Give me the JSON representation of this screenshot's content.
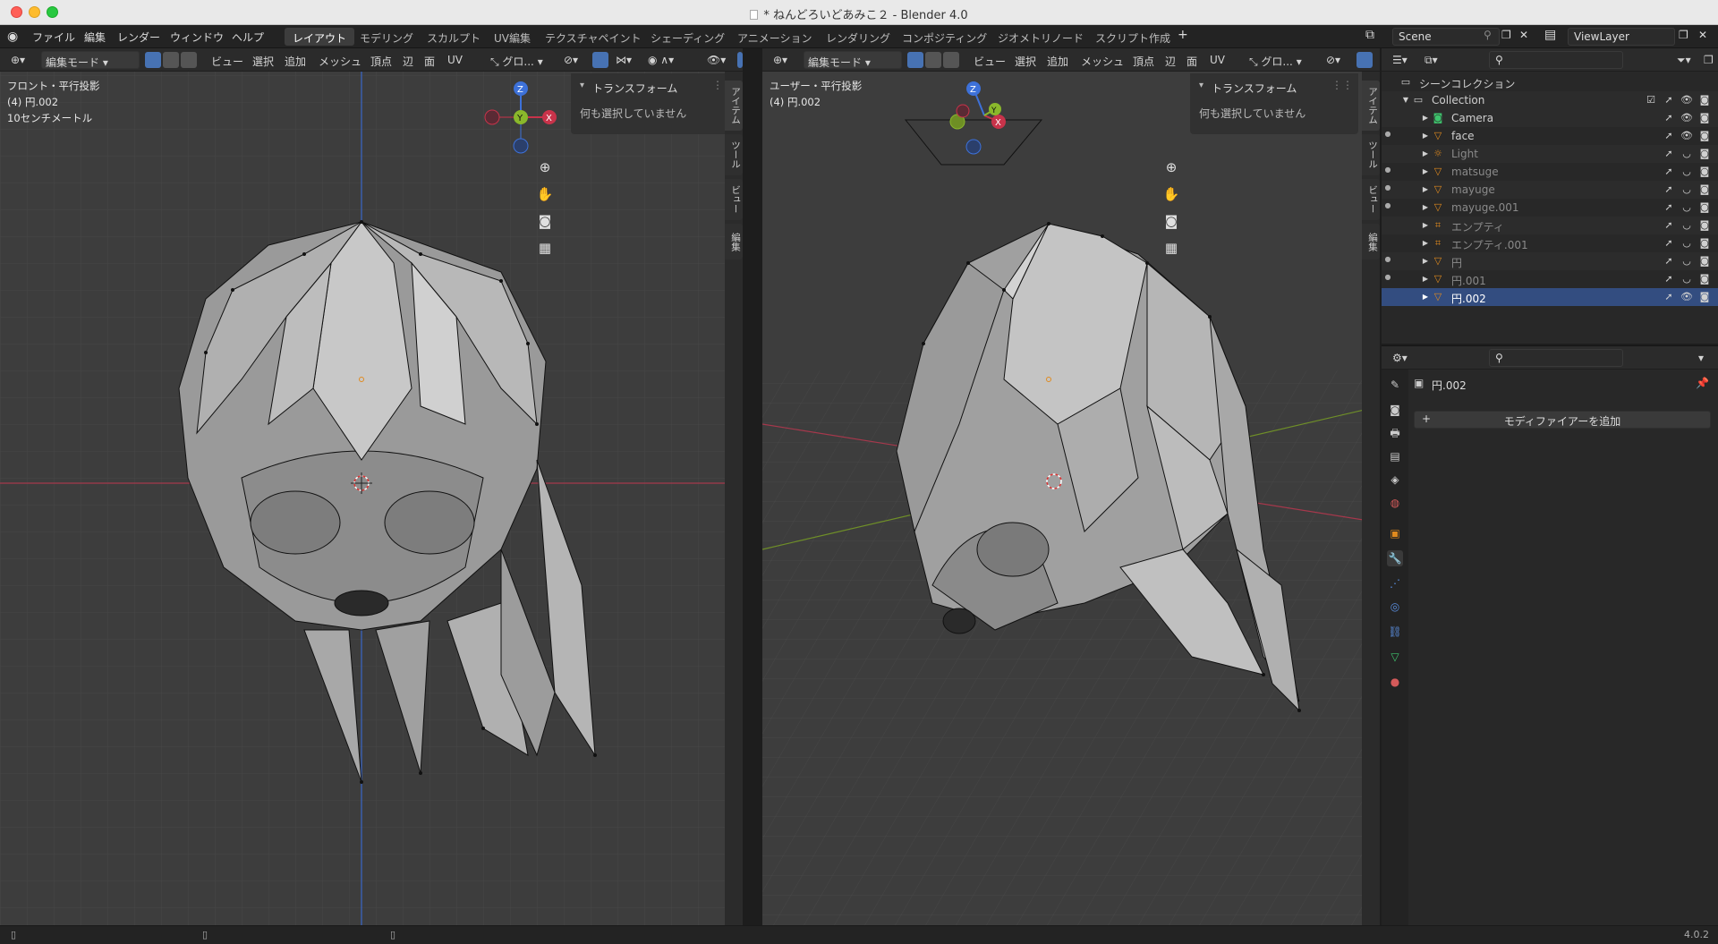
{
  "window": {
    "title": "* ねんどろいどあみこ２ - Blender 4.0"
  },
  "menu": {
    "file": "ファイル",
    "edit": "編集",
    "render": "レンダー",
    "window": "ウィンドウ",
    "help": "ヘルプ"
  },
  "workspaces": [
    {
      "label": "レイアウト",
      "active": true
    },
    {
      "label": "モデリング"
    },
    {
      "label": "スカルプト"
    },
    {
      "label": "UV編集"
    },
    {
      "label": "テクスチャペイント"
    },
    {
      "label": "シェーディング"
    },
    {
      "label": "アニメーション"
    },
    {
      "label": "レンダリング"
    },
    {
      "label": "コンポジティング"
    },
    {
      "label": "ジオメトリノード"
    },
    {
      "label": "スクリプト作成"
    }
  ],
  "scene": {
    "name": "Scene",
    "view_layer": "ViewLayer"
  },
  "viewport_left": {
    "mode": "編集モード",
    "menus": [
      "ビュー",
      "選択",
      "追加",
      "メッシュ",
      "頂点",
      "辺",
      "面",
      "UV"
    ],
    "transform_orient": "グロ...",
    "info_line1": "フロント・平行投影",
    "info_line2": "(4) 円.002",
    "info_line3": "10センチメートル",
    "panel_title": "トランスフォーム",
    "panel_msg": "何も選択していません",
    "side_tabs": [
      "アイテム",
      "ツール",
      "ビュー",
      "編集"
    ]
  },
  "viewport_right": {
    "mode": "編集モード",
    "menus": [
      "ビュー",
      "選択",
      "追加",
      "メッシュ",
      "頂点",
      "辺",
      "面",
      "UV"
    ],
    "transform_orient": "グロ...",
    "info_line1": "ユーザー・平行投影",
    "info_line2": "(4) 円.002",
    "panel_title": "トランスフォーム",
    "panel_msg": "何も選択していません",
    "side_tabs": [
      "アイテム",
      "ツール",
      "ビュー",
      "編集"
    ]
  },
  "gizmo": {
    "x": "X",
    "y": "Y",
    "z": "Z"
  },
  "outliner": {
    "root": "シーンコレクション",
    "collection": "Collection",
    "items": [
      {
        "name": "Camera"
      },
      {
        "name": "face"
      },
      {
        "name": "Light"
      },
      {
        "name": "matsuge"
      },
      {
        "name": "mayuge"
      },
      {
        "name": "mayuge.001"
      },
      {
        "name": "エンプティ"
      },
      {
        "name": "エンプティ.001"
      },
      {
        "name": "円"
      },
      {
        "name": "円.001"
      },
      {
        "name": "円.002"
      }
    ]
  },
  "properties": {
    "object_name": "円.002",
    "add_modifier": "モディファイアーを追加"
  },
  "status": {
    "version": "4.0.2"
  },
  "colors": {
    "accent": "#4772b3",
    "selection": "#334d80",
    "axis_x": "#c8334a",
    "axis_y": "#8ab82b",
    "axis_z": "#3d71d9"
  }
}
